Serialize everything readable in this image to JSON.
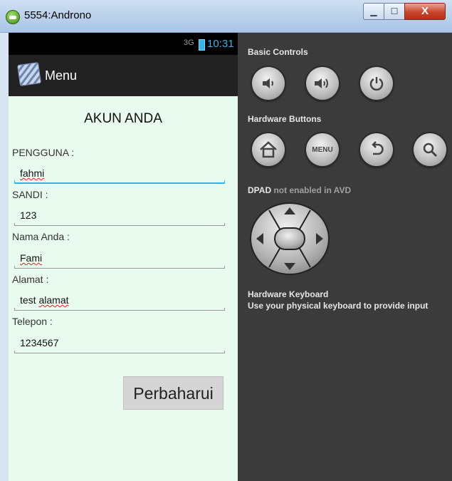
{
  "window": {
    "title": "5554:Androno",
    "minimize_glyph": "▁",
    "maximize_glyph": "☐",
    "close_glyph": "X"
  },
  "statusbar": {
    "signal": "3G",
    "time": "10:31"
  },
  "actionbar": {
    "title": "Menu",
    "icon": "app-icon"
  },
  "form": {
    "title": "AKUN ANDA",
    "username_label": "PENGGUNA :",
    "username_value": "fahmi",
    "password_label": "SANDI :",
    "password_value": "123",
    "name_label": "Nama Anda :",
    "name_value": "Fami",
    "address_label": "Alamat :",
    "address_value_plain": "test ",
    "address_value_marked": "alamat",
    "phone_label": "Telepon :",
    "phone_value": "1234567",
    "update_button": "Perbaharui"
  },
  "emulator": {
    "basic_controls_label": "Basic Controls",
    "hardware_buttons_label": "Hardware Buttons",
    "menu_button_label": "MENU",
    "dpad_label_main": "DPAD",
    "dpad_label_note": " not enabled in AVD",
    "keyboard_title": "Hardware Keyboard",
    "keyboard_desc": "Use your physical keyboard to provide input"
  },
  "colors": {
    "accent": "#33b5e5",
    "form_background": "#e9fbee",
    "emulator_background": "#3b3b3b"
  }
}
